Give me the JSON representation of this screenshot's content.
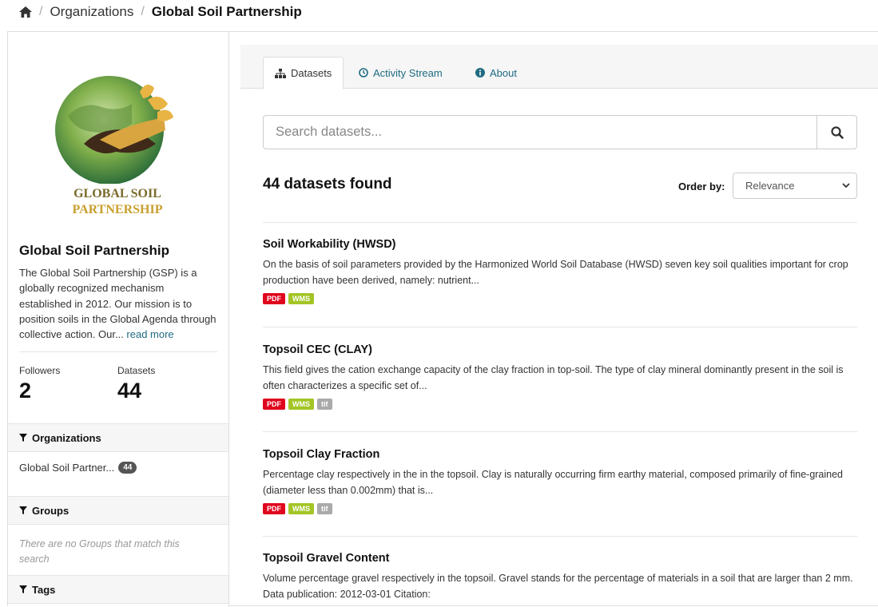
{
  "breadcrumb": {
    "home_icon": "home-icon",
    "items": [
      "Organizations",
      "Global Soil Partnership"
    ]
  },
  "sidebar": {
    "logo": {
      "line1": "GLOBAL SOIL",
      "line2": "PARTNERSHIP"
    },
    "title": "Global Soil Partnership",
    "description": "The Global Soil Partnership (GSP) is a globally recognized mechanism established in 2012. Our mission is to position soils in the Global Agenda through collective action. Our...",
    "read_more": "read more",
    "followers_label": "Followers",
    "followers_value": "2",
    "datasets_label": "Datasets",
    "datasets_value": "44",
    "facets": {
      "organizations": {
        "heading": "Organizations",
        "items": [
          {
            "label": "Global Soil Partner...",
            "count": "44"
          }
        ]
      },
      "groups": {
        "heading": "Groups",
        "empty": "There are no Groups that match this search"
      },
      "tags": {
        "heading": "Tags"
      }
    }
  },
  "tabs": [
    {
      "label": "Datasets",
      "icon": "sitemap-icon",
      "active": true
    },
    {
      "label": "Activity Stream",
      "icon": "clock-icon",
      "active": false
    },
    {
      "label": "About",
      "icon": "info-icon",
      "active": false
    }
  ],
  "search": {
    "placeholder": "Search datasets...",
    "button_icon": "search-icon"
  },
  "results": {
    "found_text": "44 datasets found",
    "order_label": "Order by:",
    "order_value": "Relevance"
  },
  "datasets": [
    {
      "title": "Soil Workability (HWSD)",
      "description": "On the basis of soil parameters provided by the Harmonized World Soil Database (HWSD) seven key soil qualities important for crop production have been derived, namely: nutrient...",
      "formats": [
        "PDF",
        "WMS"
      ]
    },
    {
      "title": "Topsoil CEC (CLAY)",
      "description": "This field gives the cation exchange capacity of the clay fraction in top-soil. The type of clay mineral dominantly present in the soil is often characterizes a specific set of...",
      "formats": [
        "PDF",
        "WMS",
        "tif"
      ]
    },
    {
      "title": "Topsoil Clay Fraction",
      "description": "Percentage clay respectively in the in the topsoil. Clay is naturally occurring firm earthy material, composed primarily of fine-grained (diameter less than 0.002mm) that is...",
      "formats": [
        "PDF",
        "WMS",
        "tif"
      ]
    },
    {
      "title": "Topsoil Gravel Content",
      "description": "Volume percentage gravel respectively in the topsoil. Gravel stands for the percentage of materials in a soil that are larger than 2 mm. Data publication: 2012-03-01 Citation:",
      "formats": []
    }
  ],
  "colors": {
    "link": "#206b82",
    "pdf": "#e0051e",
    "wms": "#a3c526",
    "tif": "#aaaaaa",
    "badge_dark": "#555555"
  }
}
